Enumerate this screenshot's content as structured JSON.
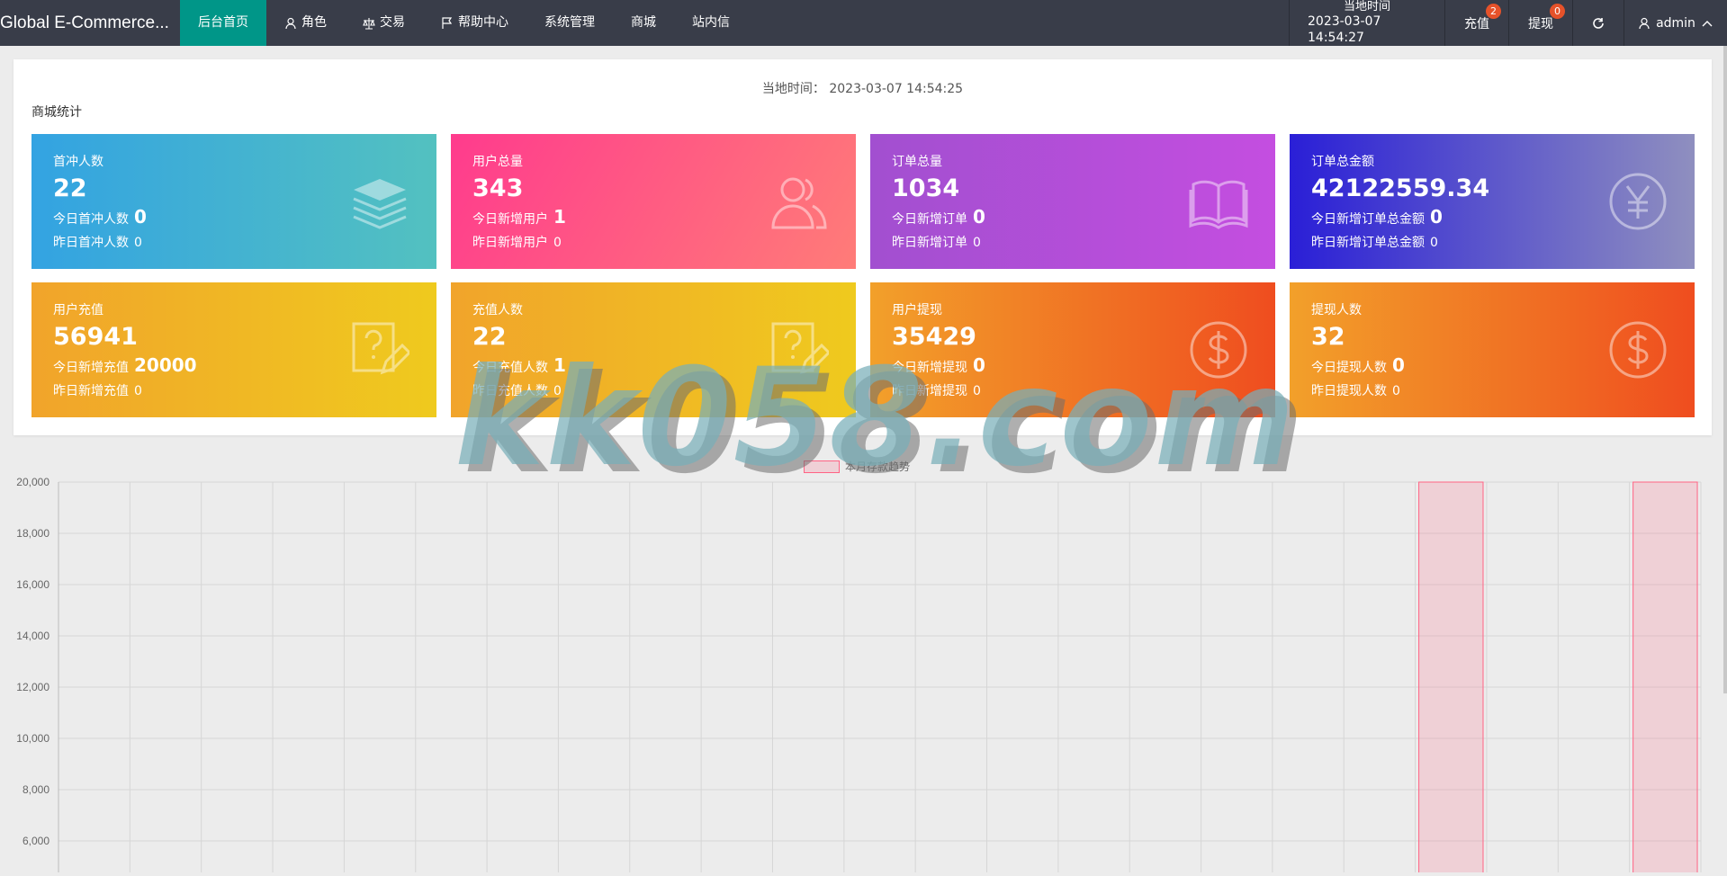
{
  "header": {
    "brand": "Global E-Commerce...",
    "nav": [
      {
        "label": "后台首页",
        "icon": ""
      },
      {
        "label": "角色",
        "icon": "user-icon"
      },
      {
        "label": "交易",
        "icon": "scale-icon"
      },
      {
        "label": "帮助中心",
        "icon": "flag-icon"
      },
      {
        "label": "系统管理",
        "icon": ""
      },
      {
        "label": "商城",
        "icon": ""
      },
      {
        "label": "站内信",
        "icon": ""
      }
    ],
    "time_label": "当地时间",
    "time_value": "2023-03-07 14:54:27",
    "recharge_label": "充值",
    "recharge_badge": "2",
    "withdraw_label": "提现",
    "withdraw_badge": "0",
    "refresh_icon": "refresh-icon",
    "admin_label": "admin",
    "admin_icon": "user-icon",
    "admin_arrow": "chevron-up-icon"
  },
  "panel": {
    "local_time": "当地时间：  2023-03-07 14:54:25",
    "section_title": "商城统计"
  },
  "cards": [
    {
      "title": "首冲人数",
      "value": "22",
      "today_label": "今日首冲人数",
      "today_value": "0",
      "yesterday_label": "昨日首冲人数",
      "yesterday_value": "0",
      "icon": "layers-icon"
    },
    {
      "title": "用户总量",
      "value": "343",
      "today_label": "今日新增用户",
      "today_value": "1",
      "yesterday_label": "昨日新增用户",
      "yesterday_value": "0",
      "icon": "users-icon"
    },
    {
      "title": "订单总量",
      "value": "1034",
      "today_label": "今日新增订单",
      "today_value": "0",
      "yesterday_label": "昨日新增订单",
      "yesterday_value": "0",
      "icon": "book-icon"
    },
    {
      "title": "订单总金额",
      "value": "42122559.34",
      "today_label": "今日新增订单总金额",
      "today_value": "0",
      "yesterday_label": "昨日新增订单总金额",
      "yesterday_value": "0",
      "icon": "yen-icon"
    },
    {
      "title": "用户充值",
      "value": "56941",
      "today_label": "今日新增充值",
      "today_value": "20000",
      "yesterday_label": "昨日新增充值",
      "yesterday_value": "0",
      "icon": "help-edit-icon"
    },
    {
      "title": "充值人数",
      "value": "22",
      "today_label": "今日充值人数",
      "today_value": "1",
      "yesterday_label": "昨日充值人数",
      "yesterday_value": "0",
      "icon": "help-edit-icon"
    },
    {
      "title": "用户提现",
      "value": "35429",
      "today_label": "今日新增提现",
      "today_value": "0",
      "yesterday_label": "昨日新增提现",
      "yesterday_value": "0",
      "icon": "dollar-icon"
    },
    {
      "title": "提现人数",
      "value": "32",
      "today_label": "今日提现人数",
      "today_value": "0",
      "yesterday_label": "昨日提现人数",
      "yesterday_value": "0",
      "icon": "dollar-icon"
    }
  ],
  "chart_data": {
    "type": "bar",
    "legend": "本月存款趋势",
    "y_ticks": [
      "20,000",
      "18,000",
      "16,000",
      "14,000",
      "12,000",
      "10,000",
      "8,000",
      "6,000"
    ],
    "ylim": [
      4000,
      20000
    ],
    "categories_count": 23,
    "values": [
      0,
      0,
      0,
      0,
      0,
      0,
      0,
      0,
      0,
      0,
      0,
      0,
      0,
      0,
      0,
      0,
      0,
      0,
      0,
      20000,
      0,
      0,
      20000
    ],
    "grid": true,
    "legend_position": "top-center",
    "bar_color": "#ff6384"
  },
  "watermark": "kk058.com"
}
